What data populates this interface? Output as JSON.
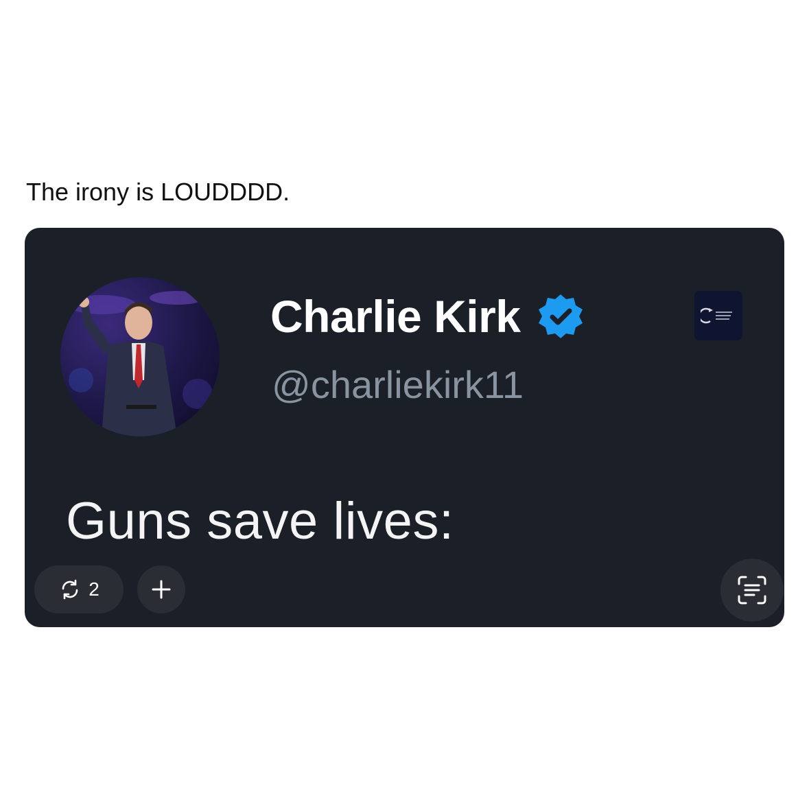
{
  "caption": "The irony is LOUDDDD.",
  "tweet": {
    "display_name": "Charlie Kirk",
    "handle": "@charliekirk11",
    "text": "Guns save lives:",
    "verified_icon": "verified-badge-icon",
    "verified_color": "#1d9bf0",
    "org_badge_icon": "organization-logo-icon"
  },
  "overlay": {
    "repost_count": "2",
    "repost_icon": "repost-icon",
    "add_icon": "plus-icon",
    "scan_icon": "live-text-scan-icon"
  },
  "colors": {
    "card_background": "#1a1f28",
    "name_color": "#ffffff",
    "handle_color": "#8a93a0",
    "button_background": "#2a2d33"
  }
}
